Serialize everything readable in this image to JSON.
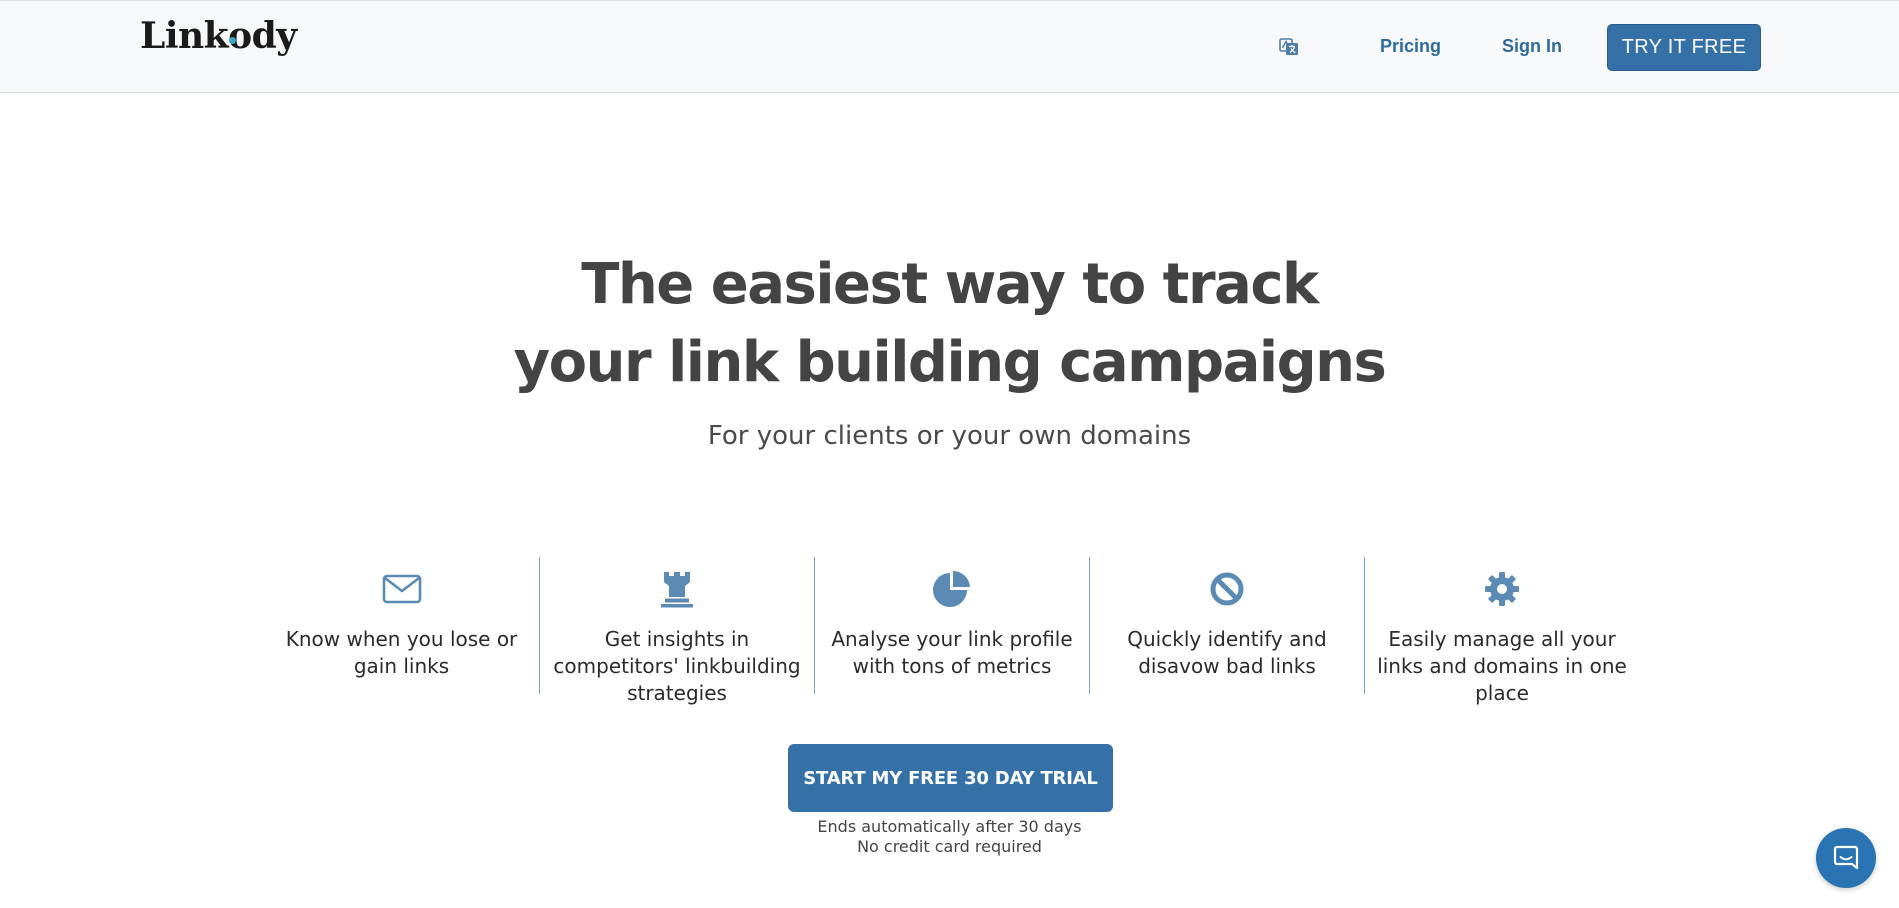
{
  "header": {
    "logo_text": "Linkody",
    "language_icon": "translate-icon",
    "nav": {
      "pricing_label": "Pricing",
      "signin_label": "Sign In",
      "try_label": "TRY IT FREE"
    }
  },
  "hero": {
    "line1_normal": "The easiest way to ",
    "line1_bold": "track",
    "line2_normal_a": "your ",
    "line2_bold": "link building",
    "line2_normal_b": " campaigns",
    "subtitle": "For your clients or your own domains"
  },
  "features": [
    {
      "icon": "envelope-icon",
      "text": "Know when you lose or gain links"
    },
    {
      "icon": "rook-icon",
      "text": "Get insights in competitors' linkbuilding strategies"
    },
    {
      "icon": "pie-chart-icon",
      "text": "Analyse your link profile with tons of metrics"
    },
    {
      "icon": "ban-icon",
      "text": "Quickly identify and disavow bad links"
    },
    {
      "icon": "gear-icon",
      "text": "Easily manage all your links and domains in one place"
    }
  ],
  "cta": {
    "button_label": "START MY FREE 30 DAY TRIAL",
    "note_line1": "Ends automatically after 30 days",
    "note_line2": "No credit card required"
  },
  "chat": {
    "icon": "chat-icon"
  },
  "colors": {
    "accent": "#3571a6",
    "nav_link": "#2f6b9b",
    "feature_icon": "#5b8ab5",
    "header_bg": "#f7f8fa"
  }
}
